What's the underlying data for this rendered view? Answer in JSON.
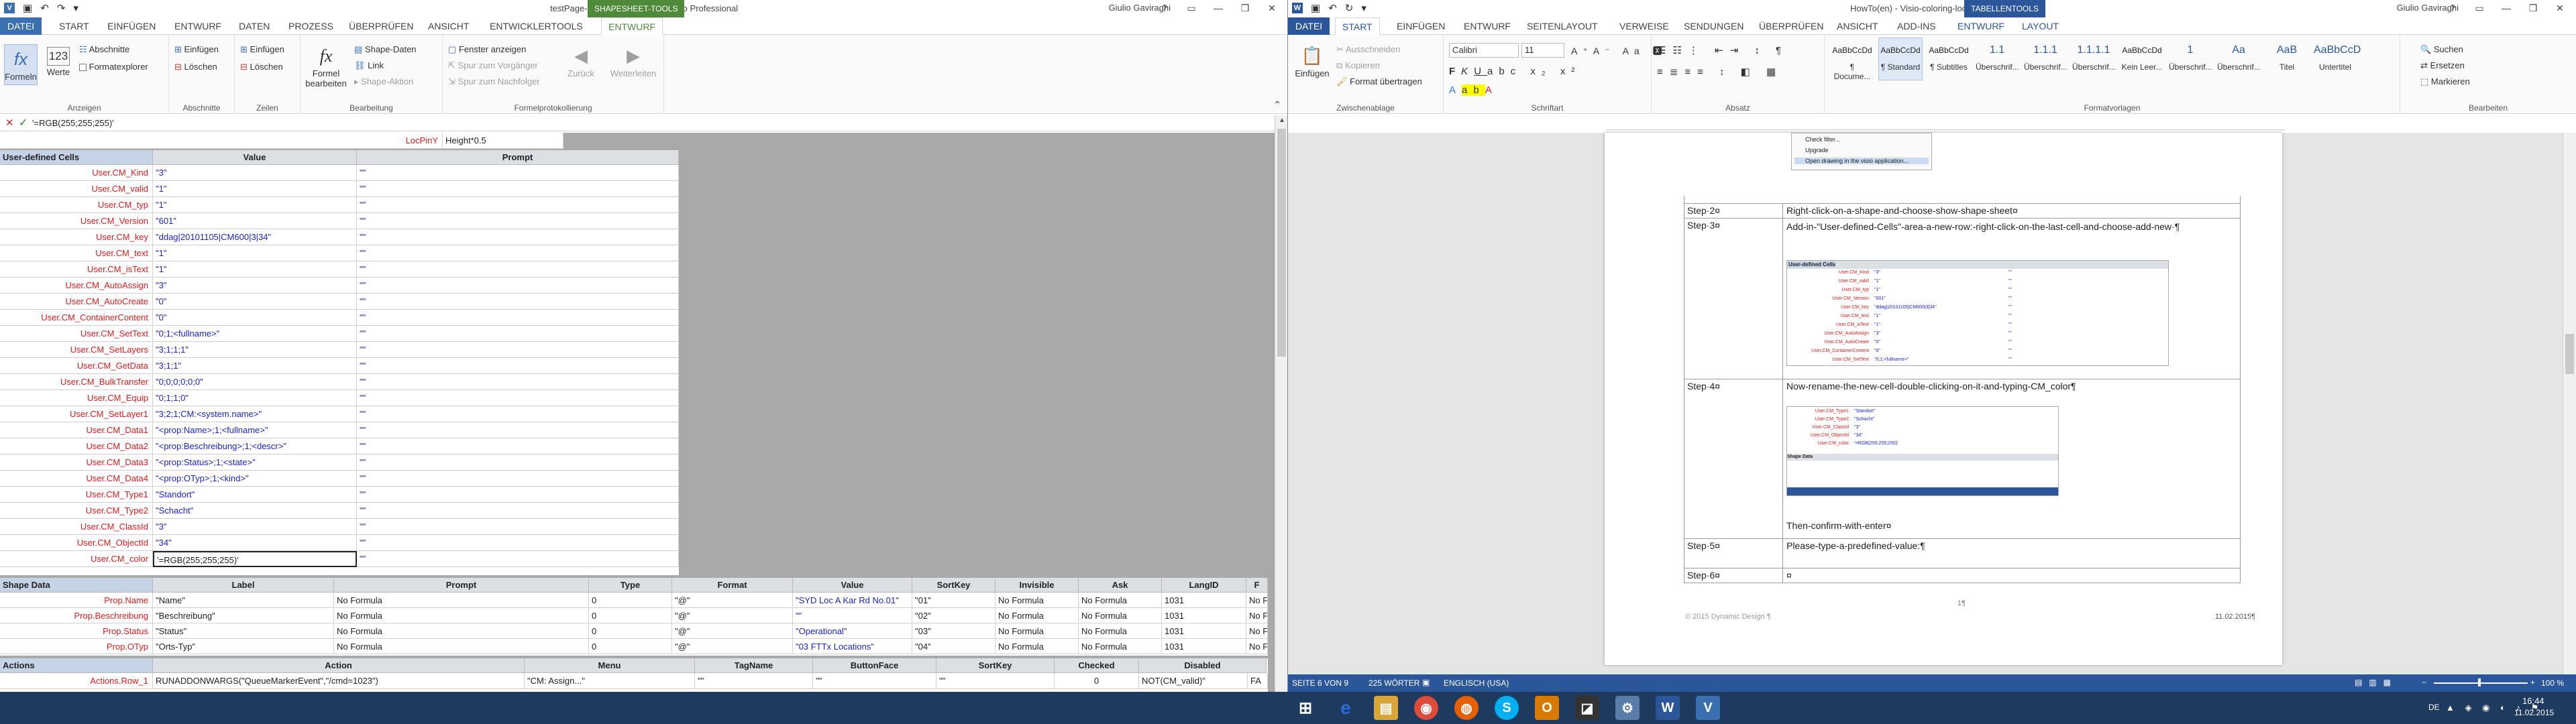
{
  "colors": {
    "visio_blue": "#3a6fb0",
    "word_blue": "#2b579a",
    "context_green": "#4f8a3a",
    "red_name": "#e31b1b",
    "blue_value": "#1a23d6",
    "shape_sel": "#d8e4f0"
  },
  "visio": {
    "title": "testPage-1:Ort.83 <SHAPE> - Visio Professional",
    "context_group": "SHAPESHEET-TOOLS",
    "user": "Giulio Gaviraghi",
    "tabs": [
      "DATEI",
      "START",
      "EINFÜGEN",
      "ENTWURF",
      "DATEN",
      "PROZESS",
      "ÜBERPRÜFEN",
      "ANSICHT",
      "ENTWICKLERTOOLS",
      "ENTWURF"
    ],
    "ribbon": {
      "anzeigen": {
        "label": "Anzeigen",
        "formeln": "Formeln",
        "werte": "Werte",
        "abschnitte": "Abschnitte",
        "formatexplorer": "Formatexplorer"
      },
      "abschnitte": {
        "label": "Abschnitte",
        "einfuegen": "Einfügen",
        "loeschen": "Löschen"
      },
      "zeilen": {
        "label": "Zeilen",
        "einfuegen": "Einfügen",
        "loeschen": "Löschen"
      },
      "bearbeitung": {
        "label": "Bearbeitung",
        "formel": "Formel bearbeiten",
        "shape_daten": "Shape-Daten",
        "link": "Link",
        "shape_aktion": "Shape-Aktion"
      },
      "formel": {
        "label": "Formelprotokollierung",
        "fenster": "Fenster anzeigen",
        "vorgaenger": "Spur zum Vorgänger",
        "nachfolger": "Spur zum Nachfolger",
        "zurueck": "Zurück",
        "weiter": "Weiterleiten"
      }
    },
    "formula_bar": {
      "value": "'=RGB(255;255;255)'",
      "fx": "fx"
    },
    "header_row": {
      "locpin_name": "LocPinY",
      "locpin_value": "Height*0.5"
    },
    "udc": {
      "header": [
        "User-defined Cells",
        "Value",
        "Prompt"
      ],
      "rows": [
        [
          "User.CM_Kind",
          "\"3\"",
          "\"\""
        ],
        [
          "User.CM_valid",
          "\"1\"",
          "\"\""
        ],
        [
          "User.CM_typ",
          "\"1\"",
          "\"\""
        ],
        [
          "User.CM_Version",
          "\"601\"",
          "\"\""
        ],
        [
          "User.CM_key",
          "\"ddag|20101105|CM600|3|34\"",
          "\"\""
        ],
        [
          "User.CM_text",
          "\"1\"",
          "\"\""
        ],
        [
          "User.CM_isText",
          "\"1\"",
          "\"\""
        ],
        [
          "User.CM_AutoAssign",
          "\"3\"",
          "\"\""
        ],
        [
          "User.CM_AutoCreate",
          "\"0\"",
          "\"\""
        ],
        [
          "User.CM_ContainerContent",
          "\"0\"",
          "\"\""
        ],
        [
          "User.CM_SetText",
          "\"0;1;<fullname>\"",
          "\"\""
        ],
        [
          "User.CM_SetLayers",
          "\"3;1;1;1\"",
          "\"\""
        ],
        [
          "User.CM_GetData",
          "\"3;1;1\"",
          "\"\""
        ],
        [
          "User.CM_BulkTransfer",
          "\"0;0;0;0;0;0\"",
          "\"\""
        ],
        [
          "User.CM_Equip",
          "\"0;1;1;0\"",
          "\"\""
        ],
        [
          "User.CM_SetLayer1",
          "\"3;2;1;CM:<system.name>\"",
          "\"\""
        ],
        [
          "User.CM_Data1",
          "\"<prop:Name>;1;<fullname>\"",
          "\"\""
        ],
        [
          "User.CM_Data2",
          "\"<prop:Beschreibung>;1;<descr>\"",
          "\"\""
        ],
        [
          "User.CM_Data3",
          "\"<prop:Status>;1;<state>\"",
          "\"\""
        ],
        [
          "User.CM_Data4",
          "\"<prop:OTyp>;1;<kind>\"",
          "\"\""
        ],
        [
          "User.CM_Type1",
          "\"Standort\"",
          "\"\""
        ],
        [
          "User.CM_Type2",
          "\"Schacht\"",
          "\"\""
        ],
        [
          "User.CM_ClassId",
          "\"3\"",
          "\"\""
        ],
        [
          "User.CM_ObjectId",
          "\"34\"",
          "\"\""
        ],
        [
          "User.CM_color",
          "'=RGB(255;255;255)'",
          "\"\""
        ]
      ]
    },
    "shape_data": {
      "header": [
        "Shape Data",
        "Label",
        "Prompt",
        "Type",
        "Format",
        "Value",
        "SortKey",
        "Invisible",
        "Ask",
        "LangID",
        "F"
      ],
      "rows": [
        [
          "Prop.Name",
          "\"Name\"",
          "No Formula",
          "0",
          "\"@\"",
          "\"SYD Loc A Kar Rd No.01\"",
          "\"01\"",
          "No Formula",
          "No Formula",
          "1031",
          "No F"
        ],
        [
          "Prop.Beschreibung",
          "\"Beschreibung\"",
          "No Formula",
          "0",
          "\"@\"",
          "\"\"",
          "\"02\"",
          "No Formula",
          "No Formula",
          "1031",
          "No F"
        ],
        [
          "Prop.Status",
          "\"Status\"",
          "No Formula",
          "0",
          "\"@\"",
          "\"Operational\"",
          "\"03\"",
          "No Formula",
          "No Formula",
          "1031",
          "No F"
        ],
        [
          "Prop.OTyp",
          "\"Orts-Typ\"",
          "No Formula",
          "0",
          "\"@\"",
          "\"03 FTTx Locations\"",
          "\"04\"",
          "No Formula",
          "No Formula",
          "1031",
          "No F"
        ]
      ]
    },
    "actions": {
      "header": [
        "Actions",
        "Action",
        "Menu",
        "TagName",
        "ButtonFace",
        "SortKey",
        "Checked",
        "Disabled"
      ],
      "row": [
        "Actions.Row_1",
        "RUNADDONWARGS(\"QueueMarkerEvent\",\"/cmd=1023\")",
        "\"CM: Assign...\"",
        "\"\"",
        "\"\"",
        "\"\"",
        "0",
        "NOT(CM_valid)\"",
        "FA"
      ]
    }
  },
  "word": {
    "title": "HowTo(en) - Visio-coloring-location - Word",
    "context_group": "TABELLENTOOLS",
    "user": "Giulio Gaviraghi",
    "tabs": [
      "DATEI",
      "START",
      "EINFÜGEN",
      "ENTWURF",
      "SEITENLAYOUT",
      "VERWEISE",
      "SENDUNGEN",
      "ÜBERPRÜFEN",
      "ANSICHT",
      "ADD-INS",
      "ENTWURF",
      "LAYOUT"
    ],
    "ribbon": {
      "clipboard": {
        "label": "Zwischenablage",
        "paste": "Einfügen",
        "cut": "Ausschneiden",
        "copy": "Kopieren",
        "format": "Format übertragen"
      },
      "font": {
        "label": "Schriftart",
        "name": "Calibri",
        "size": "11"
      },
      "paragraph": {
        "label": "Absatz"
      },
      "styles": {
        "label": "Formatvorlagen",
        "items": [
          [
            "AaBbCcDd",
            "¶ Docume..."
          ],
          [
            "AaBbCcDd",
            "¶ Standard"
          ],
          [
            "AaBbCcDd",
            "¶ Subtitles"
          ],
          [
            "1.1",
            "Überschrif..."
          ],
          [
            "1.1.1",
            "Überschrif..."
          ],
          [
            "1.1.1.1",
            "Überschrif..."
          ],
          [
            "AaBbCcDd",
            "Kein Leer..."
          ],
          [
            "1",
            "Überschrif..."
          ],
          [
            "Aa",
            "Überschrif..."
          ],
          [
            "AaB",
            "Titel"
          ],
          [
            "AaBbCcD",
            "Untertitel"
          ]
        ]
      },
      "edit": {
        "label": "Bearbeiten",
        "find": "Suchen",
        "replace": "Ersetzen",
        "select": "Markieren"
      }
    },
    "doc": {
      "top_menu": [
        "Check filter...",
        "Upgrade",
        "Open drawing in the visio application..."
      ],
      "steps": [
        {
          "step": "Step·2¤",
          "text": "Right-click-on-a-shape-and-choose-show-shape-sheet¤"
        },
        {
          "step": "Step·3¤",
          "text": "Add-in-\"User-defined-Cells\"-area-a-new-row:-right-click-on-the-last-cell-and-choose-add-new·¶"
        },
        {
          "step": "Step·4¤",
          "text": "Now-rename-the-new-cell-double-clicking-on-it-and-typing-CM_color¶"
        },
        {
          "step": "Step·5¤",
          "text": "Please-type-a-predefined-value:¶"
        },
        {
          "step": "Step·6¤",
          "text": "¤"
        }
      ],
      "confirm": "Then-confirm-with-enter¤",
      "footer_left": "© 2015 Dynamic Design ¶",
      "footer_right": "11.02.2015¶",
      "page_num": "1¶"
    },
    "status": {
      "page": "SEITE 6 VON 9",
      "words": "225 WÖRTER",
      "lang": "ENGLISCH (USA)",
      "zoom": "100 %"
    }
  },
  "taskbar": {
    "lang": "DE",
    "time": "16:44",
    "date": "11.02.2015"
  }
}
